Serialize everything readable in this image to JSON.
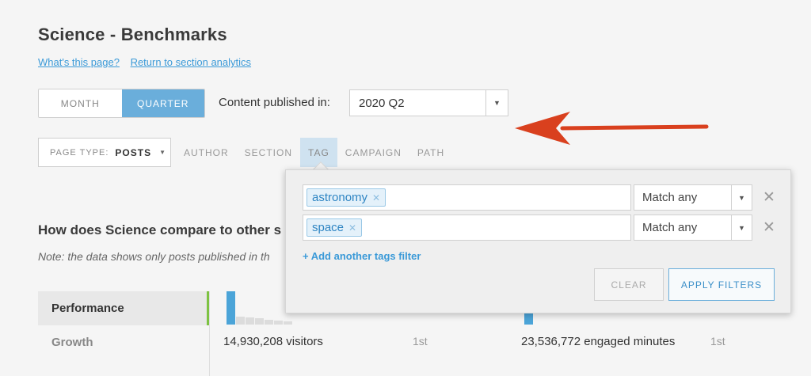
{
  "page": {
    "title": "Science  - Benchmarks",
    "links": [
      "What's this page?",
      "Return to section analytics"
    ]
  },
  "period": {
    "options": [
      "MONTH",
      "QUARTER"
    ],
    "selected": "QUARTER"
  },
  "published": {
    "label": "Content published in:",
    "value": "2020 Q2"
  },
  "page_type": {
    "label": "PAGE TYPE:",
    "value": "POSTS"
  },
  "filter_tabs": [
    "AUTHOR",
    "SECTION",
    "TAG",
    "CAMPAIGN",
    "PATH"
  ],
  "filter_tabs_active": "TAG",
  "tag_filters": {
    "rows": [
      {
        "tag": "astronomy",
        "match": "Match any"
      },
      {
        "tag": "space",
        "match": "Match any"
      }
    ],
    "add_label": "+ Add another tags filter",
    "clear_label": "CLEAR",
    "apply_label": "APPLY FILTERS"
  },
  "comparison": {
    "heading": "How does Science compare to other s",
    "note": "Note: the data shows only posts published in th"
  },
  "side_nav": {
    "items": [
      "Performance",
      "Growth"
    ],
    "active": "Performance"
  },
  "stats": [
    {
      "value": "14,930,208 visitors",
      "rank": "1st"
    },
    {
      "value": "23,536,772 engaged minutes",
      "rank": "1st"
    }
  ],
  "colors": {
    "accent": "#6aaedb",
    "link": "#3b9ad8",
    "arrow": "#d9401e",
    "active_border": "#7dc242"
  }
}
